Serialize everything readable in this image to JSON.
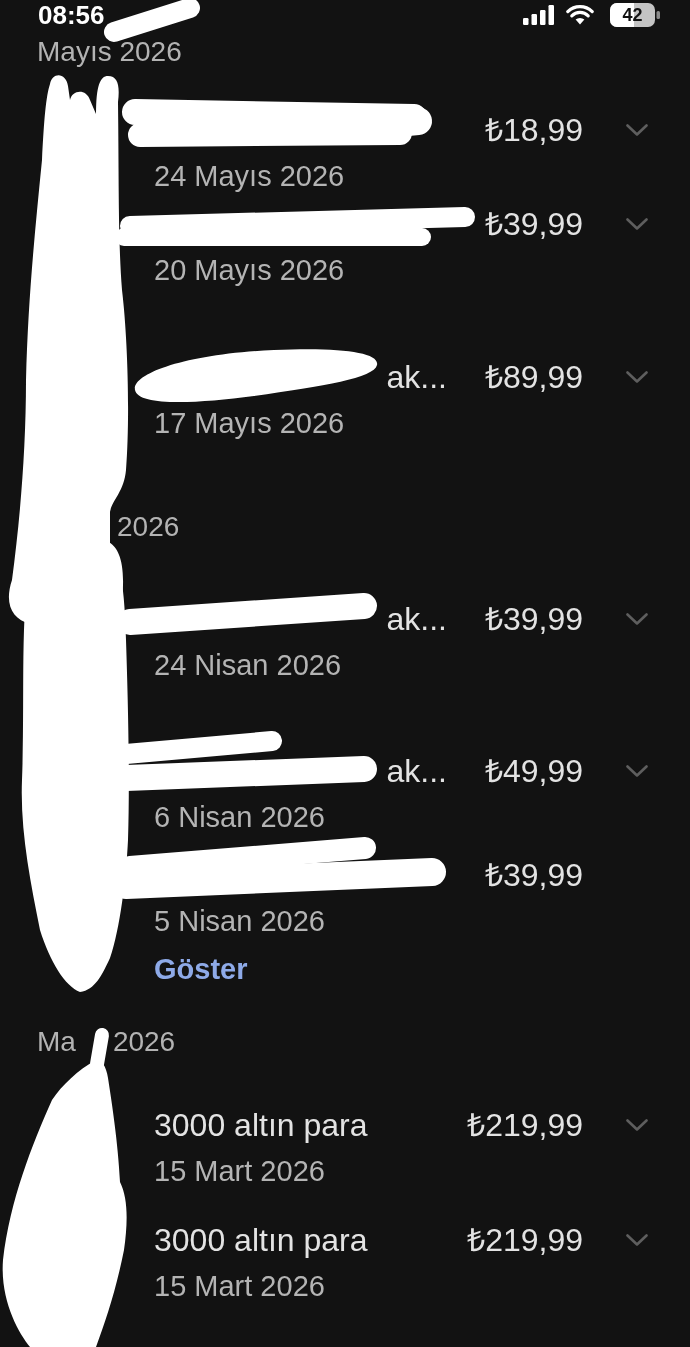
{
  "status_bar": {
    "time": "08:56",
    "battery": "42"
  },
  "sections": [
    {
      "header": {
        "parts": [
          "Mayıs 2026"
        ]
      },
      "items": [
        {
          "redacted": true,
          "price": "₺18,99",
          "date": "24 Mayıs 2026",
          "expandable": true
        },
        {
          "redacted": true,
          "price": "₺39,99",
          "date": "20 Mayıs 2026",
          "expandable": true
        },
        {
          "redacted": true,
          "title": "ak...",
          "price": "₺89,99",
          "date": "17 Mayıs 2026",
          "expandable": true
        }
      ]
    },
    {
      "header": {
        "parts": [
          "2026"
        ]
      },
      "items": [
        {
          "redacted": true,
          "title": "ak...",
          "price": "₺39,99",
          "date": "24 Nisan 2026",
          "expandable": true
        },
        {
          "redacted": true,
          "title": "ak...",
          "price": "₺49,99",
          "date": "6 Nisan 2026",
          "expandable": true
        },
        {
          "redacted": true,
          "price": "₺39,99",
          "date": "5 Nisan 2026",
          "expandable": false,
          "link": "Göster"
        }
      ]
    },
    {
      "header": {
        "parts": [
          "Ma",
          "2026"
        ]
      },
      "items": [
        {
          "redacted": false,
          "title": "3000 altın para",
          "price": "₺219,99",
          "date": "15 Mart 2026",
          "expandable": true
        },
        {
          "redacted": false,
          "title": "3000 altın para",
          "price": "₺219,99",
          "date": "15 Mart 2026",
          "expandable": true
        }
      ]
    }
  ]
}
